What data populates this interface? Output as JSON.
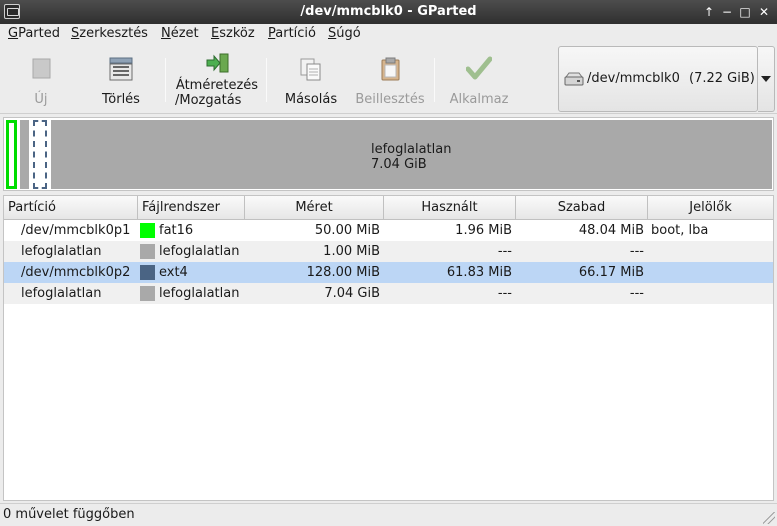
{
  "window": {
    "title": "/dev/mmcblk0 - GParted",
    "controls": [
      "↑",
      "−",
      "□",
      "✕"
    ]
  },
  "menubar": {
    "items": [
      {
        "accel": "G",
        "rest": "Parted"
      },
      {
        "accel": "S",
        "rest": "zerkesztés"
      },
      {
        "accel": "N",
        "rest": "ézet"
      },
      {
        "accel": "E",
        "rest": "szköz"
      },
      {
        "accel": "P",
        "rest": "artíció"
      },
      {
        "accel": "S",
        "rest": "úgó"
      }
    ]
  },
  "toolbar": {
    "new_label": "Új",
    "delete_label": "Törlés",
    "resize_label_line1": "Átméretezés",
    "resize_label_line2": "/Mozgatás",
    "copy_label": "Másolás",
    "paste_label": "Beillesztés",
    "apply_label": "Alkalmaz"
  },
  "device": {
    "name": "/dev/mmcblk0",
    "size": "(7.22 GiB)",
    "icon": "drive-icon"
  },
  "diskmap": {
    "large_segment_line1": "lefoglalatlan",
    "large_segment_line2": "7.04 GiB"
  },
  "table": {
    "headers": [
      "Partíció",
      "Fájlrendszer",
      "Méret",
      "Használt",
      "Szabad",
      "Jelölők"
    ],
    "rows": [
      {
        "partition": "/dev/mmcblk0p1",
        "fs": "fat16",
        "fs_color": "#00ff00",
        "size": "50.00 MiB",
        "used": "1.96 MiB",
        "free": "48.04 MiB",
        "flags": "boot, lba"
      },
      {
        "partition": "lefoglalatlan",
        "fs": "lefoglalatlan",
        "fs_color": "#a9a9a9",
        "size": "1.00 MiB",
        "used": "---",
        "free": "---",
        "flags": ""
      },
      {
        "partition": "/dev/mmcblk0p2",
        "fs": "ext4",
        "fs_color": "#4a6484",
        "size": "128.00 MiB",
        "used": "61.83 MiB",
        "free": "66.17 MiB",
        "flags": ""
      },
      {
        "partition": "lefoglalatlan",
        "fs": "lefoglalatlan",
        "fs_color": "#a9a9a9",
        "size": "7.04 GiB",
        "used": "---",
        "free": "---",
        "flags": ""
      }
    ]
  },
  "status": {
    "text": "0 művelet függőben"
  }
}
